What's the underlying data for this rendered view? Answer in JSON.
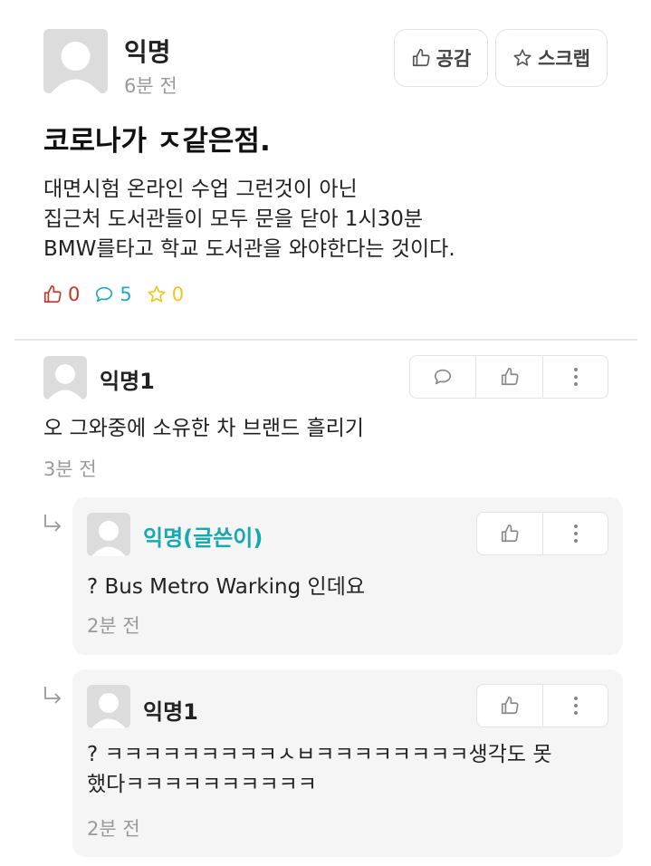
{
  "post": {
    "author": "익명",
    "time": "6분 전",
    "like_label": "공감",
    "scrap_label": "스크랩",
    "title": "코로나가 ㅈ같은점.",
    "body_lines": [
      "대면시험 온라인 수업 그런것이 아닌",
      "집근처 도서관들이 모두 문을 닫아 1시30분",
      "BMW를타고 학교 도서관을 와야한다는 것이다."
    ],
    "stats": {
      "likes": "0",
      "comments": "5",
      "scraps": "0"
    }
  },
  "comments": [
    {
      "author": "익명1",
      "text": "오 그와중에 소유한 차 브랜드 흘리기",
      "time": "3분 전",
      "replies": [
        {
          "author": "익명(글쓴이)",
          "text": "? Bus Metro Warking 인데요",
          "time": "2분 전"
        },
        {
          "author": "익명1",
          "text_lines": [
            "? ㅋㅋㅋㅋㅋㅋㅋㅋㅋㅅㅂㅋㅋㅋㅋㅋㅋㅋㅋ생각도 못",
            "했다ㅋㅋㅋㅋㅋㅋㅋㅋㅋㅋ"
          ],
          "time": "2분 전"
        }
      ]
    }
  ],
  "colors": {
    "like_red": "#c2362b",
    "comment_cyan": "#1ea8c4",
    "scrap_yellow": "#f5c31a",
    "writer_teal": "#18a8b0",
    "muted": "#9a9a9a"
  }
}
